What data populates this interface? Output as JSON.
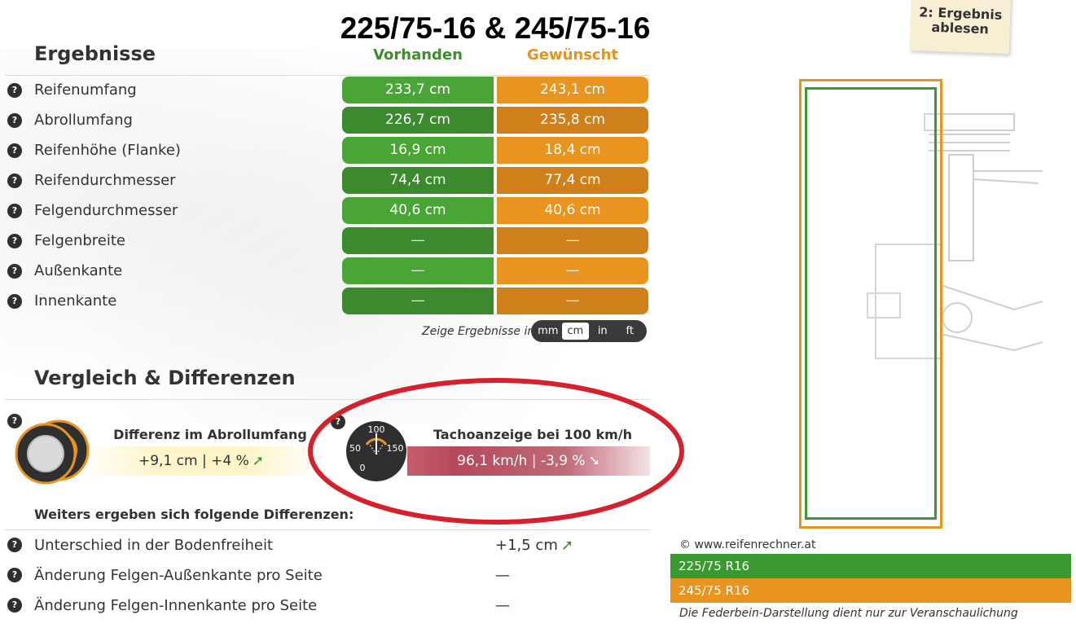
{
  "title": "225/75-16 & 245/75-16",
  "results": {
    "heading": "Ergebnisse",
    "col_existing": "Vorhanden",
    "col_desired": "Gewünscht",
    "rows": [
      {
        "label": "Reifenumfang",
        "existing": "233,7 cm",
        "desired": "243,1 cm"
      },
      {
        "label": "Abrollumfang",
        "existing": "226,7 cm",
        "desired": "235,8 cm"
      },
      {
        "label": "Reifenhöhe (Flanke)",
        "existing": "16,9 cm",
        "desired": "18,4 cm"
      },
      {
        "label": "Reifendurchmesser",
        "existing": "74,4 cm",
        "desired": "77,4 cm"
      },
      {
        "label": "Felgendurchmesser",
        "existing": "40,6 cm",
        "desired": "40,6 cm"
      },
      {
        "label": "Felgenbreite",
        "existing": "—",
        "desired": "—"
      },
      {
        "label": "Außenkante",
        "existing": "—",
        "desired": "—"
      },
      {
        "label": "Innenkante",
        "existing": "—",
        "desired": "—"
      }
    ],
    "unit_label": "Zeige Ergebnisse in",
    "units": [
      "mm",
      "cm",
      "in",
      "ft"
    ],
    "active_unit": "cm"
  },
  "help_glyph": "?",
  "comparison": {
    "heading": "Vergleich & Differenzen",
    "roll_diff_title": "Differenz im Abrollumfang",
    "roll_diff_value": "+9,1 cm | +4 %",
    "roll_diff_arrow": "➚",
    "tacho_title": "Tachoanzeige bei 100 km/h",
    "tacho_value": "96,1 km/h | -3,9 %",
    "tacho_arrow": "➘",
    "gauge_labels": {
      "top": "100",
      "left": "50",
      "right": "150",
      "bottom": "0"
    }
  },
  "further": {
    "heading": "Weiters ergeben sich folgende Differenzen:",
    "rows": [
      {
        "label": "Unterschied in der Bodenfreiheit",
        "value": "+1,5 cm",
        "arrow": "➚"
      },
      {
        "label": "Änderung Felgen-Außenkante pro Seite",
        "value": "—",
        "arrow": ""
      },
      {
        "label": "Änderung Felgen-Innenkante pro Seite",
        "value": "—",
        "arrow": ""
      }
    ]
  },
  "sticky_note": {
    "line1": "2: Ergebnis",
    "line2": "ablesen"
  },
  "illustration": {
    "copyright": "© www.reifenrechner.at",
    "legend_existing": "225/75 R16",
    "legend_desired": "245/75 R16",
    "footnote": "Die Federbein-Darstellung dient nur zur Veranschaulichung"
  },
  "colors": {
    "green": "#4aa537",
    "orange": "#e8941f",
    "highlight_red": "#d6202b"
  }
}
